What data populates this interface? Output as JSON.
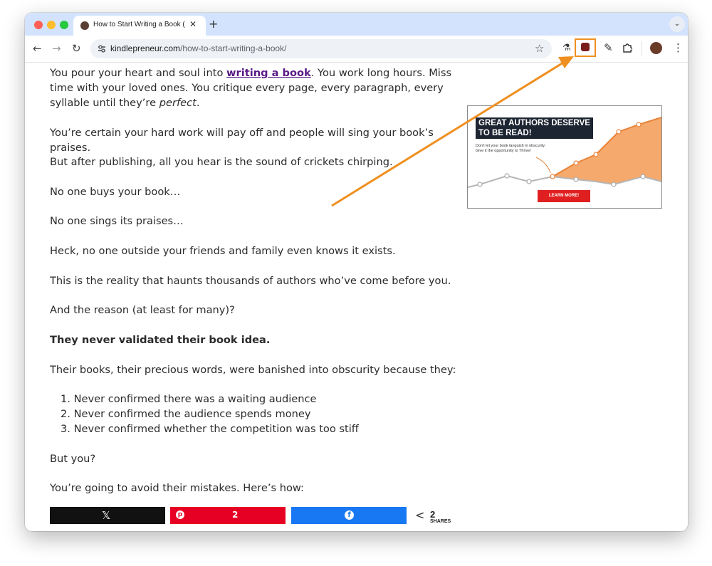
{
  "browser": {
    "tab_title": "How to Start Writing a Book (",
    "close_glyph": "✕",
    "new_tab_glyph": "+",
    "url_domain": "kindlepreneur.com",
    "url_path": "/how-to-start-writing-a-book/"
  },
  "article": {
    "p1_pre": "You pour your heart and soul into ",
    "p1_link": "writing a book",
    "p1_post": ". You work long hours. Miss time with your loved ones. You critique every page, every paragraph, every syllable until they’re ",
    "p1_em": "perfect",
    "p1_end": ".",
    "p2": "You’re certain your hard work will pay off and people will sing your book’s praises.",
    "p3": "But after publishing, all you hear is the sound of crickets chirping.",
    "p4": "No one buys your book…",
    "p5": "No one sings its praises…",
    "p6": "Heck, no one outside your friends and family even knows it exists.",
    "p7": "This is the reality that haunts thousands of authors who’ve come before you.",
    "p8": "And the reason (at least for many)?",
    "p9": "They never validated their book idea.",
    "p10": "Their books, their precious words, were banished into obscurity because they:",
    "list": [
      "Never confirmed there was a waiting audience",
      "Never confirmed the audience spends money",
      "Never confirmed whether the competition was too stiff"
    ],
    "p11": "But you?",
    "p12": "You’re going to avoid their mistakes. Here’s how:"
  },
  "ad": {
    "headline_1": "GREAT AUTHORS DESERVE",
    "headline_2": "TO BE READ!",
    "sub_1": "Don't let your book languish in obscurity.",
    "sub_2": "Give it the opportunity to Thrive!",
    "button": "LEARN MORE!"
  },
  "share": {
    "pinterest_count": "2",
    "total": "2",
    "label": "SHARES"
  },
  "colors": {
    "highlight": "#ef8f1f",
    "link": "#5a1a86",
    "x_button": "#111111",
    "pinterest_button": "#e60023",
    "facebook_button": "#1877f2"
  }
}
